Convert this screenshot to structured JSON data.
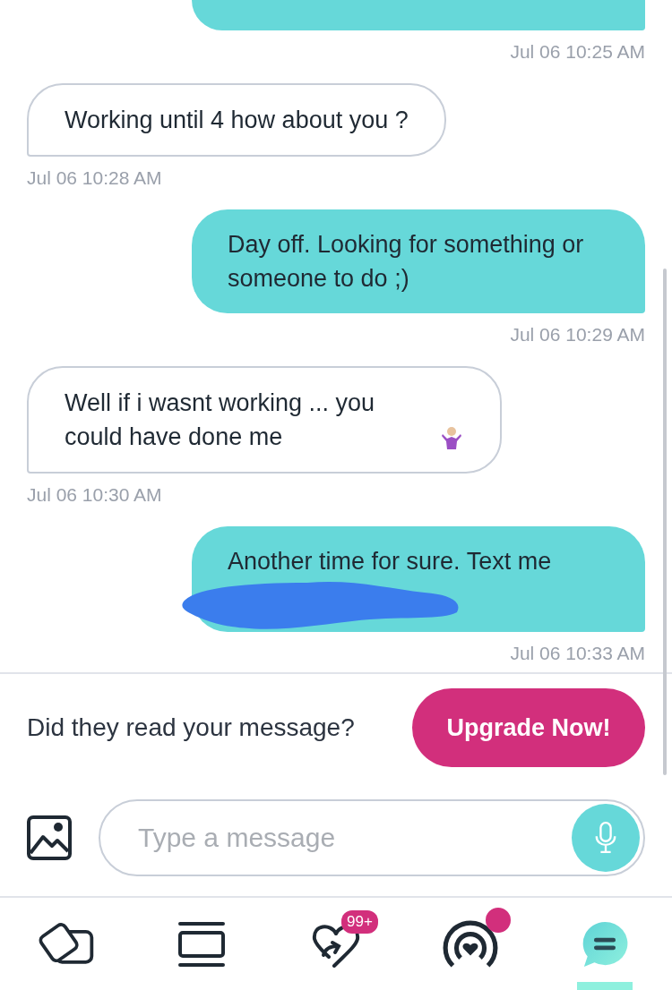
{
  "messages": [
    {
      "kind": "sent",
      "time": "Jul 06 10:25 AM"
    },
    {
      "kind": "received",
      "text": "Working until 4 how about you ?",
      "time": "Jul 06 10:28 AM"
    },
    {
      "kind": "sent",
      "text": "Day off. Looking for something or someone to do ;)",
      "time": "Jul 06 10:29 AM"
    },
    {
      "kind": "received",
      "text": "Well if i wasnt working ... you could have  done me",
      "emoji": true,
      "time": "Jul 06 10:30 AM"
    },
    {
      "kind": "sent",
      "text": "Another time for sure. Text me",
      "redacted": true,
      "time": "Jul 06 10:33 AM"
    }
  ],
  "upgrade": {
    "prompt": "Did they read your message?",
    "button": "Upgrade Now!"
  },
  "composer": {
    "placeholder": "Type a message"
  },
  "nav": [
    {
      "kind": "cards",
      "selected": false
    },
    {
      "kind": "list",
      "selected": false
    },
    {
      "kind": "likes",
      "selected": false,
      "badge": "99+"
    },
    {
      "kind": "live",
      "selected": false,
      "dot": true
    },
    {
      "kind": "chat",
      "selected": true
    }
  ]
}
